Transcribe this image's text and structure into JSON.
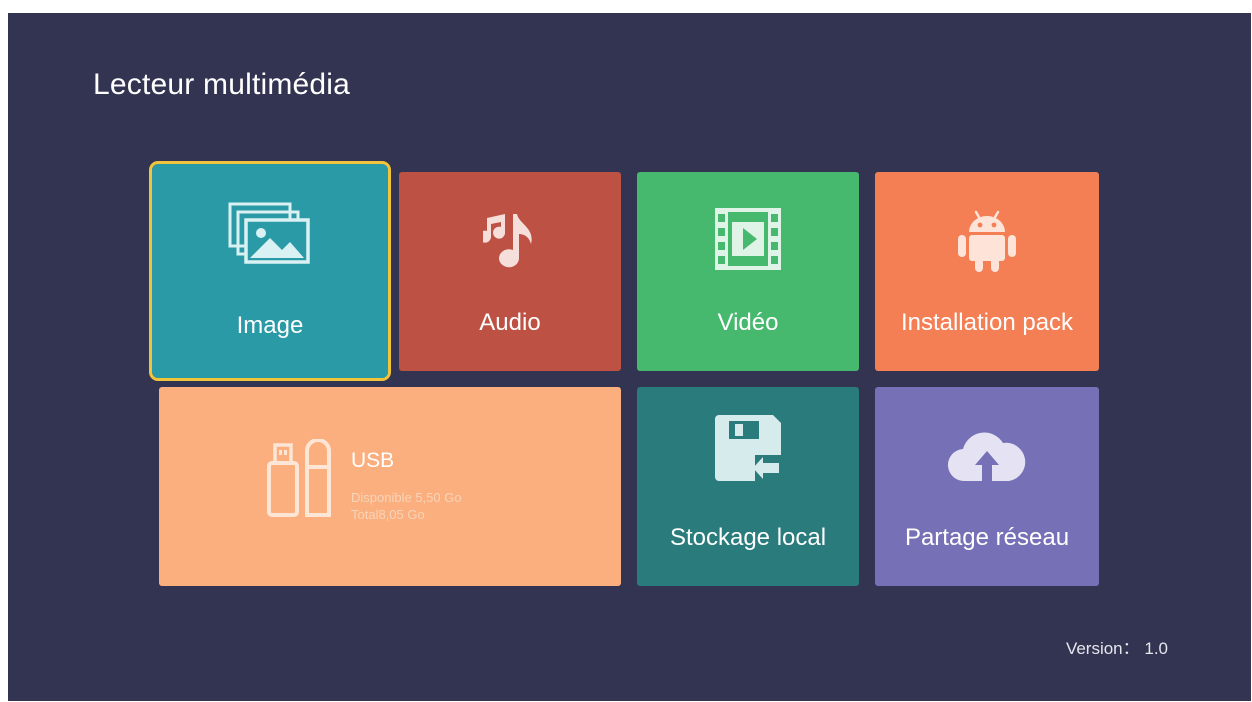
{
  "header": {
    "title": "Lecteur multimédia"
  },
  "tiles": {
    "image": {
      "label": "Image",
      "color": "#2a9aa6",
      "icon": "image-gallery-icon"
    },
    "audio": {
      "label": "Audio",
      "color": "#bd5143",
      "icon": "music-note-icon"
    },
    "video": {
      "label": "Vidéo",
      "color": "#46b96e",
      "icon": "film-icon"
    },
    "installation": {
      "label": "Installation pack",
      "color": "#f57f55",
      "icon": "android-icon"
    },
    "usb": {
      "label": "USB",
      "available": "Disponible 5,50 Go",
      "total": "Total8,05 Go",
      "color": "#fbaf7e",
      "icon": "usb-drive-icon"
    },
    "local_storage": {
      "label": "Stockage local",
      "color": "#2a7b7c",
      "icon": "floppy-storage-icon"
    },
    "network_share": {
      "label": "Partage réseau",
      "color": "#7670b6",
      "icon": "cloud-upload-icon"
    }
  },
  "footer": {
    "version": "Version： 1.0"
  },
  "focused_tile": "image"
}
